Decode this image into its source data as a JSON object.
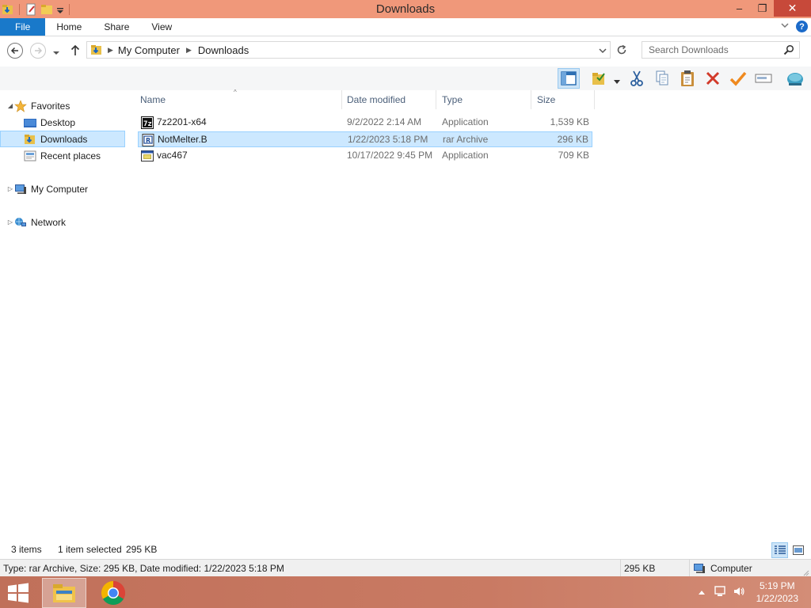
{
  "window": {
    "title": "Downloads",
    "controls": {
      "minimize": "–",
      "maximize": "❐",
      "close": "✕"
    }
  },
  "ribbon": {
    "tabs": [
      "File",
      "Home",
      "Share",
      "View"
    ],
    "help": "?"
  },
  "address": {
    "path": [
      "My Computer",
      "Downloads"
    ],
    "search_placeholder": "Search Downloads"
  },
  "navpane": {
    "favorites_label": "Favorites",
    "items": [
      "Desktop",
      "Downloads",
      "Recent places"
    ],
    "computer_label": "My Computer",
    "network_label": "Network"
  },
  "columns": [
    "Name",
    "Date modified",
    "Type",
    "Size"
  ],
  "files": [
    {
      "name": "7z2201-x64",
      "date": "9/2/2022 2:14 AM",
      "type": "Application",
      "size": "1,539 KB",
      "icon": "7zip-installer-icon"
    },
    {
      "name": "NotMelter.B",
      "date": "1/22/2023 5:18 PM",
      "type": "rar Archive",
      "size": "296 KB",
      "icon": "rar-archive-icon",
      "selected": true
    },
    {
      "name": "vac467",
      "date": "10/17/2022 9:45 PM",
      "type": "Application",
      "size": "709 KB",
      "icon": "application-icon"
    }
  ],
  "status": {
    "item_count": "3 items",
    "selection": "1 item selected",
    "selection_size": "295 KB"
  },
  "classic_status": {
    "details": "Type: rar Archive, Size: 295 KB, Date modified: 1/22/2023 5:18 PM",
    "size": "295 KB",
    "zone": "Computer"
  },
  "taskbar": {
    "time": "5:19 PM",
    "date": "1/22/2023"
  },
  "colors": {
    "titlebar": "#f0987a",
    "file_tab": "#1979ca",
    "selection": "#cce8ff",
    "taskbar": "#c0705a"
  }
}
